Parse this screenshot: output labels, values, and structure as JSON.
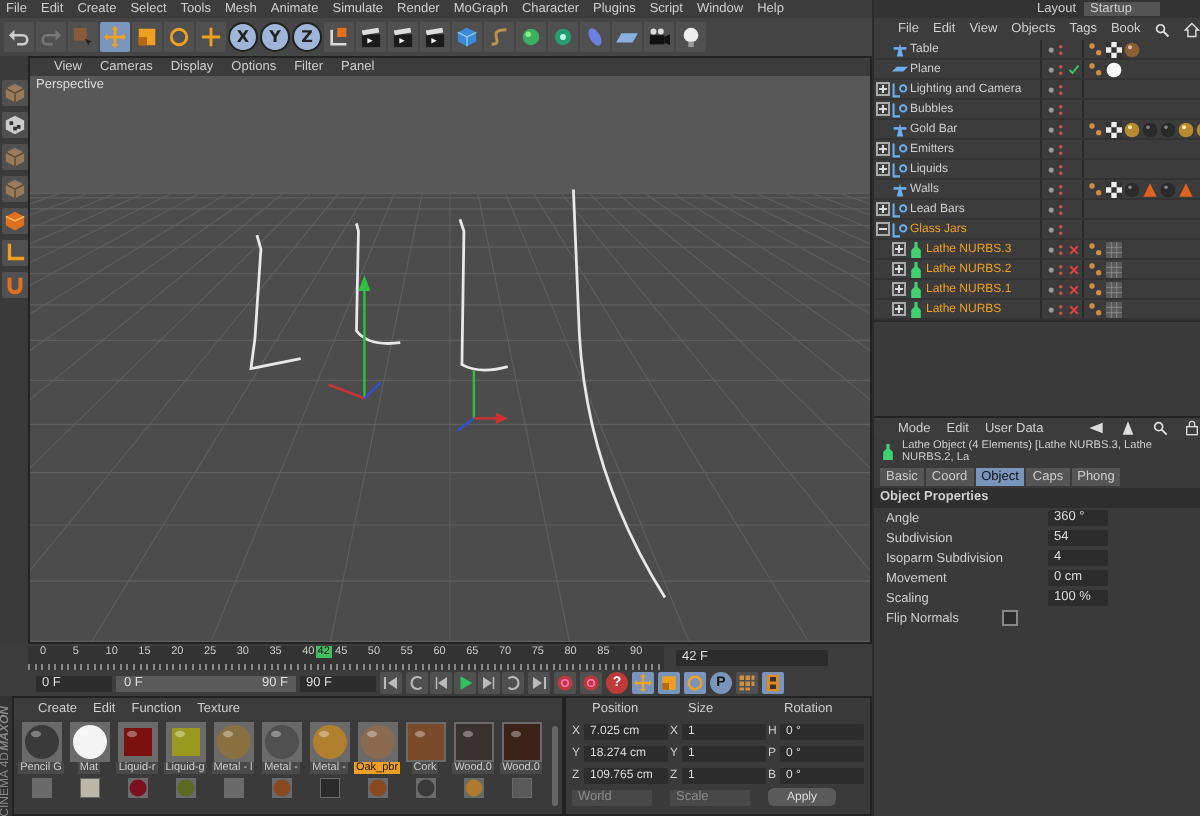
{
  "menu_bar": [
    "File",
    "Edit",
    "Create",
    "Select",
    "Tools",
    "Mesh",
    "Animate",
    "Simulate",
    "Render",
    "MoGraph",
    "Character",
    "Plugins",
    "Script",
    "Window",
    "Help"
  ],
  "axis_buttons": [
    {
      "label": "X",
      "selected": true
    },
    {
      "label": "Y",
      "selected": true
    },
    {
      "label": "Z",
      "selected": true
    }
  ],
  "viewport": {
    "menu": [
      "View",
      "Cameras",
      "Display",
      "Options",
      "Filter",
      "Panel"
    ],
    "camera": "Perspective"
  },
  "layout": {
    "label": "Layout",
    "value": "Startup"
  },
  "object_manager": {
    "menu": [
      "File",
      "Edit",
      "View",
      "Objects",
      "Tags",
      "Book"
    ],
    "objects": [
      {
        "name": "Table",
        "kind": "polygon",
        "selected": false,
        "tags": [
          {
            "kind": "phong"
          },
          {
            "kind": "checker"
          },
          {
            "kind": "bronze"
          }
        ]
      },
      {
        "name": "Plane",
        "kind": "plane",
        "selected": false,
        "status": {
          "kind": "check"
        },
        "tags": [
          {
            "kind": "phong"
          },
          {
            "kind": "white"
          }
        ]
      },
      {
        "name": "Lighting and Camera",
        "kind": "null",
        "selected": false,
        "expanded": false
      },
      {
        "name": "Bubbles",
        "kind": "null",
        "selected": false,
        "expanded": false
      },
      {
        "name": "Gold Bar",
        "kind": "polygon",
        "selected": false,
        "tags": [
          {
            "kind": "phong"
          },
          {
            "kind": "checker"
          },
          {
            "kind": "gold"
          },
          {
            "kind": "dark"
          },
          {
            "kind": "dark"
          },
          {
            "kind": "gold"
          },
          {
            "kind": "gold"
          }
        ]
      },
      {
        "name": "Emitters",
        "kind": "null",
        "selected": false,
        "expanded": false
      },
      {
        "name": "Liquids",
        "kind": "null",
        "selected": false,
        "expanded": false
      },
      {
        "name": "Walls",
        "kind": "polygon",
        "selected": false,
        "tags": [
          {
            "kind": "phong"
          },
          {
            "kind": "checker"
          },
          {
            "kind": "dark"
          },
          {
            "kind": "warning"
          },
          {
            "kind": "dark"
          },
          {
            "kind": "warning"
          }
        ]
      },
      {
        "name": "Lead Bars",
        "kind": "null",
        "selected": false,
        "expanded": false
      },
      {
        "name": "Glass Jars",
        "kind": "null",
        "selected": true,
        "expanded": true,
        "children": [
          {
            "name": "Lathe NURBS.3",
            "kind": "lathe",
            "selected": true,
            "expanded": false,
            "status": {
              "kind": "x"
            },
            "tags": [
              {
                "kind": "phong"
              },
              {
                "kind": "texture"
              }
            ]
          },
          {
            "name": "Lathe NURBS.2",
            "kind": "lathe",
            "selected": true,
            "expanded": false,
            "status": {
              "kind": "x"
            },
            "tags": [
              {
                "kind": "phong"
              },
              {
                "kind": "texture"
              }
            ]
          },
          {
            "name": "Lathe NURBS.1",
            "kind": "lathe",
            "selected": true,
            "expanded": false,
            "status": {
              "kind": "x"
            },
            "tags": [
              {
                "kind": "phong"
              },
              {
                "kind": "texture"
              }
            ]
          },
          {
            "name": "Lathe NURBS",
            "kind": "lathe",
            "selected": true,
            "expanded": false,
            "status": {
              "kind": "x"
            },
            "tags": [
              {
                "kind": "phong"
              },
              {
                "kind": "texture"
              }
            ]
          }
        ]
      }
    ]
  },
  "attributes": {
    "menu": [
      "Mode",
      "Edit",
      "User Data"
    ],
    "title": "Lathe Object (4 Elements) [Lathe NURBS.3, Lathe NURBS.2, La",
    "tabs": [
      {
        "label": "Basic",
        "selected": false
      },
      {
        "label": "Coord",
        "selected": false
      },
      {
        "label": "Object",
        "selected": true
      },
      {
        "label": "Caps",
        "selected": false
      },
      {
        "label": "Phong",
        "selected": false
      }
    ],
    "section": "Object Properties",
    "fields": [
      {
        "label": "Angle",
        "kind": "number",
        "value": "360 °"
      },
      {
        "label": "Subdivision",
        "kind": "number",
        "value": "54"
      },
      {
        "label": "Isoparm Subdivision",
        "kind": "number",
        "value": "4"
      },
      {
        "label": "Movement",
        "kind": "number",
        "value": "0 cm"
      },
      {
        "label": "Scaling",
        "kind": "number",
        "value": "100 %"
      },
      {
        "label": "Flip Normals",
        "kind": "checkbox",
        "checked": false
      }
    ]
  },
  "timeline": {
    "ticks": [
      "0",
      "5",
      "10",
      "15",
      "20",
      "25",
      "30",
      "35",
      "40",
      "45",
      "50",
      "55",
      "60",
      "65",
      "70",
      "75",
      "80",
      "85",
      "90"
    ],
    "playhead": {
      "label": "42",
      "level": 0.4667
    },
    "frame_field": "42 F",
    "start_field": "0 F",
    "range": {
      "start": "0 F",
      "end": "90 F",
      "level": 1
    },
    "end_field": "90 F",
    "help_key": "?",
    "param_key": "P"
  },
  "materials": {
    "menu": [
      "Create",
      "Edit",
      "Function",
      "Texture"
    ],
    "row_1": [
      {
        "label": "Pencil G",
        "kind": "sphere",
        "color": "#3a3a3a",
        "selected": false
      },
      {
        "label": "Mat",
        "kind": "sphere",
        "color": "#f4f4f4",
        "selected": false
      },
      {
        "label": "Liquid-r",
        "kind": "cube",
        "color": "#7a1010",
        "selected": false
      },
      {
        "label": "Liquid-g",
        "kind": "cube",
        "color": "#9a9a20",
        "selected": false
      },
      {
        "label": "Metal - l",
        "kind": "sphere",
        "color": "#8a7040",
        "selected": false
      },
      {
        "label": "Metal -",
        "kind": "sphere",
        "color": "#505050",
        "selected": false
      },
      {
        "label": "Metal -",
        "kind": "sphere",
        "color": "#b08030",
        "selected": false
      },
      {
        "label": "Oak_pbr",
        "kind": "sphere",
        "color": "#8a6a50",
        "selected": true
      },
      {
        "label": "Cork",
        "kind": "flat",
        "color": "#7a4a2a",
        "selected": false
      },
      {
        "label": "Wood.0",
        "kind": "flat",
        "color": "#3a3230",
        "selected": false
      },
      {
        "label": "Wood.0",
        "kind": "flat",
        "color": "#3a2218",
        "selected": false
      }
    ],
    "row_2": [
      {
        "kind": "flat",
        "color": "#6a6a6a"
      },
      {
        "kind": "flat",
        "color": "#bcb8a8"
      },
      {
        "kind": "sphere",
        "color": "#7a1020"
      },
      {
        "kind": "sphere",
        "color": "#5a6a20"
      },
      {
        "kind": "sphere",
        "color": "#6a6a6a"
      },
      {
        "kind": "sphere",
        "color": "#8a4a20"
      },
      {
        "kind": "flat",
        "color": "#2a2a2a"
      },
      {
        "kind": "sphere",
        "color": "#8a4a20"
      },
      {
        "kind": "sphere",
        "color": "#3a3a3a"
      },
      {
        "kind": "sphere",
        "color": "#b07a30"
      },
      {
        "kind": "flat",
        "color": "#5a5a5a"
      }
    ]
  },
  "coordinates": {
    "headers": [
      "Position",
      "Size",
      "Rotation"
    ],
    "rows": [
      {
        "cells": [
          {
            "axis": "X",
            "value": "7.025 cm"
          },
          {
            "axis": "X",
            "value": "1"
          },
          {
            "axis": "H",
            "value": "0 °"
          }
        ]
      },
      {
        "cells": [
          {
            "axis": "Y",
            "value": "18.274 cm"
          },
          {
            "axis": "Y",
            "value": "1"
          },
          {
            "axis": "P",
            "value": "0 °"
          }
        ]
      },
      {
        "cells": [
          {
            "axis": "Z",
            "value": "109.765 cm"
          },
          {
            "axis": "Z",
            "value": "1"
          },
          {
            "axis": "B",
            "value": "0 °"
          }
        ]
      }
    ],
    "dropdowns": [
      {
        "value": "World",
        "disabled": true
      },
      {
        "value": "Scale",
        "disabled": true
      }
    ],
    "apply": "Apply"
  },
  "logo": {
    "brand": "MAXON",
    "product": "CINEMA 4D"
  }
}
